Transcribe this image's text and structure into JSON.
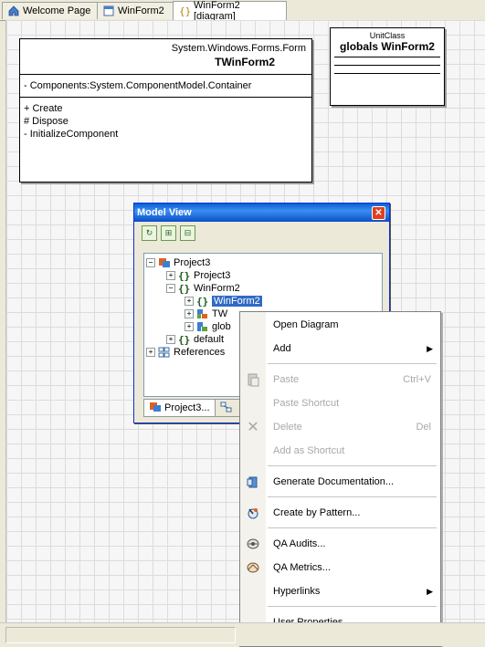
{
  "tabs": [
    {
      "label": "Welcome Page",
      "icon": "home-icon"
    },
    {
      "label": "WinForm2",
      "icon": "form-icon"
    },
    {
      "label": "WinForm2 [diagram]",
      "icon": "diagram-icon"
    }
  ],
  "class_form": {
    "stereotype": "System.Windows.Forms.Form",
    "name": "TWinForm2",
    "fields": [
      "- Components:System.ComponentModel.Container"
    ],
    "methods": [
      "+ Create",
      "# Dispose",
      "- InitializeComponent"
    ]
  },
  "class_unit": {
    "stereotype": "UnitClass",
    "name": "globals WinForm2"
  },
  "model_view": {
    "title": "Model View",
    "toolbar": [
      "refresh-icon",
      "expand-all-icon",
      "collapse-all-icon"
    ],
    "tree": [
      {
        "label": "Project3",
        "expander": "−",
        "icon": "project-icon"
      },
      {
        "label": "Project3",
        "expander": "+",
        "icon": "namespace-icon"
      },
      {
        "label": "WinForm2",
        "expander": "−",
        "icon": "namespace-icon"
      },
      {
        "label": "WinForm2",
        "expander": "+",
        "icon": "namespace-icon"
      },
      {
        "label": "TW",
        "expander": "+",
        "icon": "class-icon"
      },
      {
        "label": "glob",
        "expander": "+",
        "icon": "class-icon"
      },
      {
        "label": "default",
        "expander": "+",
        "icon": "namespace-icon"
      },
      {
        "label": "References",
        "expander": "+",
        "icon": "references-icon"
      }
    ],
    "bottom_tabs": [
      "Project3...",
      ""
    ]
  },
  "context_menu": {
    "items": [
      {
        "label": "Open Diagram",
        "shortcut": "",
        "submenu": false,
        "disabled": false,
        "icon": ""
      },
      {
        "label": "Add",
        "shortcut": "",
        "submenu": true,
        "disabled": false,
        "icon": ""
      },
      {
        "label": "Paste",
        "shortcut": "Ctrl+V",
        "submenu": false,
        "disabled": true,
        "icon": "paste-icon"
      },
      {
        "label": "Paste Shortcut",
        "shortcut": "",
        "submenu": false,
        "disabled": true,
        "icon": ""
      },
      {
        "label": "Delete",
        "shortcut": "Del",
        "submenu": false,
        "disabled": true,
        "icon": "delete-icon"
      },
      {
        "label": "Add as Shortcut",
        "shortcut": "",
        "submenu": false,
        "disabled": true,
        "icon": ""
      },
      {
        "label": "Generate Documentation...",
        "shortcut": "",
        "submenu": false,
        "disabled": false,
        "icon": "documentation-icon"
      },
      {
        "label": "Create by Pattern...",
        "shortcut": "",
        "submenu": false,
        "disabled": false,
        "icon": "pattern-icon"
      },
      {
        "label": "QA Audits...",
        "shortcut": "",
        "submenu": false,
        "disabled": false,
        "icon": "qa-audits-icon"
      },
      {
        "label": "QA Metrics...",
        "shortcut": "",
        "submenu": false,
        "disabled": false,
        "icon": "qa-metrics-icon"
      },
      {
        "label": "Hyperlinks",
        "shortcut": "",
        "submenu": true,
        "disabled": false,
        "icon": ""
      },
      {
        "label": "User Properties...",
        "shortcut": "",
        "submenu": false,
        "disabled": false,
        "icon": ""
      }
    ]
  },
  "colors": {
    "accent": "#316ac5",
    "titlebar": "#0a5fd8",
    "canvas": "#f6f6f6"
  }
}
